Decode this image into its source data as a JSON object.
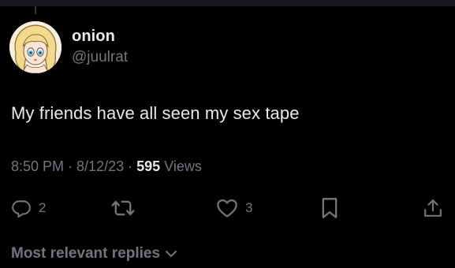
{
  "tweet": {
    "author": {
      "display_name": "onion",
      "handle": "@juulrat"
    },
    "text": "My friends have all seen my sex tape",
    "time": "8:50 PM",
    "separator1": " · ",
    "date": "8/12/23",
    "separator2": " · ",
    "views_count": "595",
    "views_label": " Views"
  },
  "actions": {
    "reply_icon": "reply-icon",
    "reply_count": "2",
    "retweet_icon": "retweet-icon",
    "like_icon": "heart-icon",
    "like_count": "3",
    "bookmark_icon": "bookmark-icon",
    "share_icon": "share-icon"
  },
  "replies": {
    "sort_label": "Most relevant replies"
  },
  "colors": {
    "background": "#000000",
    "primary_text": "#e7e9ea",
    "secondary_text": "#71767b"
  }
}
